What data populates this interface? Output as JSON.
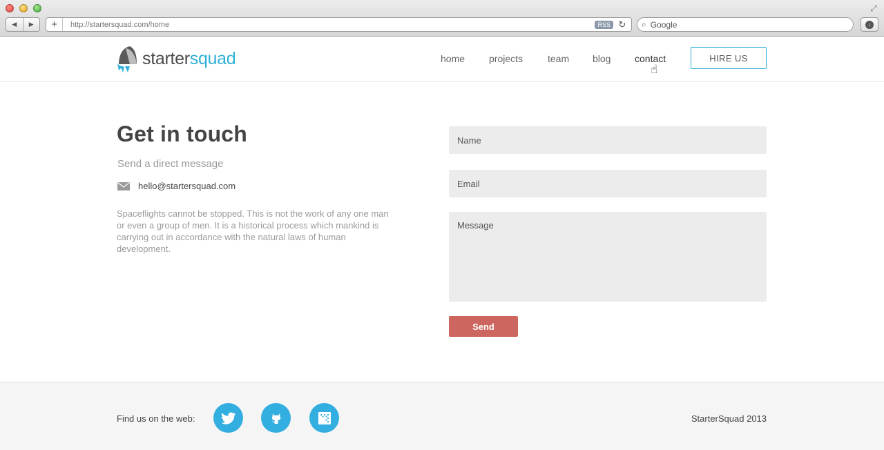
{
  "browser": {
    "url": "http://startersquad.com/home",
    "rss_label": "RSS",
    "search_placeholder": "Google"
  },
  "site": {
    "logo": {
      "part1": "starter",
      "part2": "squad"
    },
    "nav": [
      {
        "label": "home"
      },
      {
        "label": "projects"
      },
      {
        "label": "team"
      },
      {
        "label": "blog"
      },
      {
        "label": "contact"
      }
    ],
    "hire_label": "HIRE US"
  },
  "contact": {
    "title": "Get in touch",
    "subtitle": "Send a direct message",
    "email": "hello@startersquad.com",
    "body": "Spaceflights cannot be stopped. This is not the work of any one man or even a group of men. It is a historical process which mankind is carrying out in accordance with the natural laws of human development.",
    "form": {
      "name_placeholder": "Name",
      "email_placeholder": "Email",
      "message_placeholder": "Message",
      "send_label": "Send"
    }
  },
  "footer": {
    "find_label": "Find us on the web:",
    "social": [
      "twitter-icon",
      "github-icon",
      "dribbble-icon"
    ],
    "copyright": "StarterSquad 2013"
  },
  "colors": {
    "accent": "#2fb0d8",
    "send_button": "#cc665e",
    "social_circle": "#33aee0",
    "footer_bg": "#f5f5f5",
    "input_bg": "#ececec"
  }
}
